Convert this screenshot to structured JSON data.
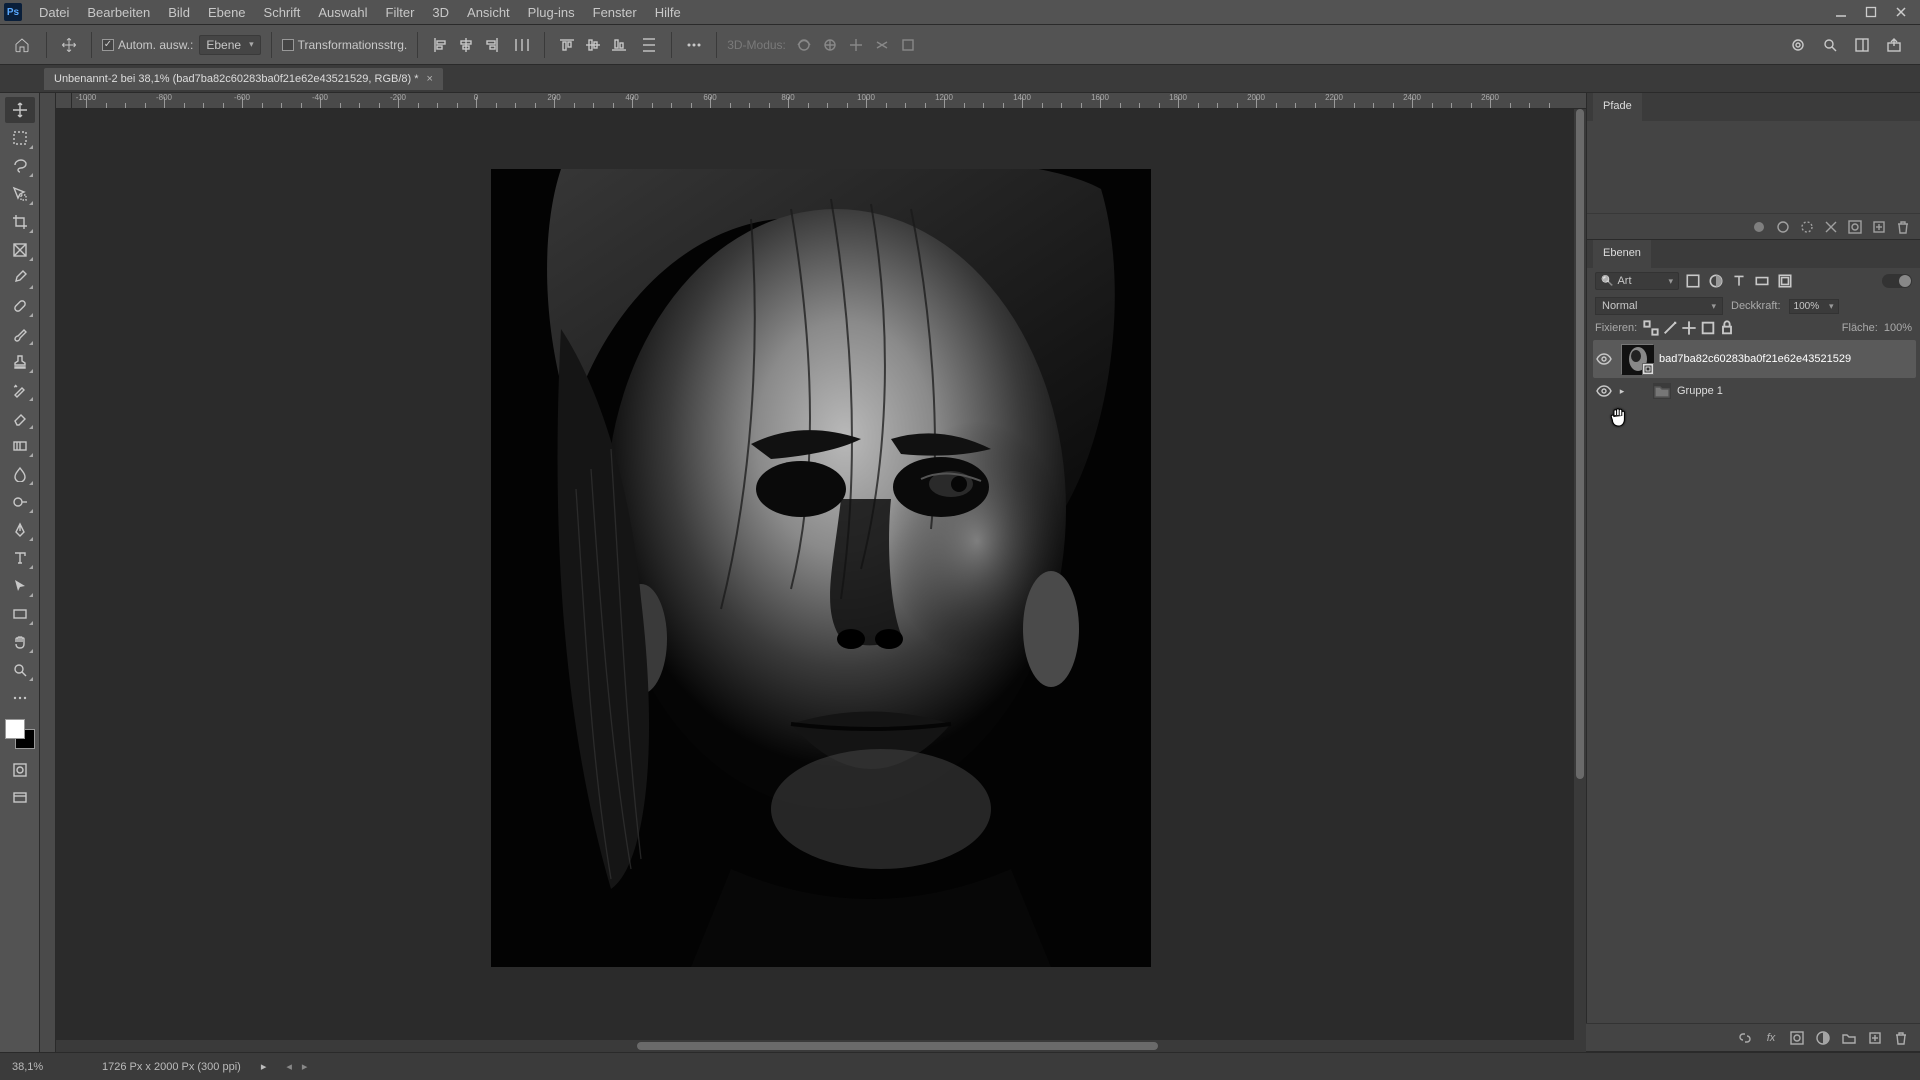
{
  "menubar": {
    "items": [
      "Datei",
      "Bearbeiten",
      "Bild",
      "Ebene",
      "Schrift",
      "Auswahl",
      "Filter",
      "3D",
      "Ansicht",
      "Plug-ins",
      "Fenster",
      "Hilfe"
    ]
  },
  "optbar": {
    "auto_select_label": "Autom. ausw.:",
    "auto_select_checked": true,
    "auto_select_target": "Ebene",
    "show_transform_label": "Transformationsstrg.",
    "show_transform_checked": false,
    "mode_3d_label": "3D-Modus:"
  },
  "document": {
    "tab_title": "Unbenannt-2 bei 38,1% (bad7ba82c60283ba0f21e62e43521529, RGB/8) *"
  },
  "ruler": {
    "h_labels": [
      "-1000",
      "-800",
      "-600",
      "-400",
      "-200",
      "0",
      "200",
      "400",
      "600",
      "800",
      "1000",
      "1200",
      "1400",
      "1600",
      "1800",
      "2000",
      "2200",
      "2400",
      "2600"
    ]
  },
  "panels": {
    "paths_tab": "Pfade",
    "layers_tab": "Ebenen",
    "search_kind": "Art",
    "blend_mode": "Normal",
    "opacity_label": "Deckkraft:",
    "opacity_value": "100%",
    "lock_label": "Fixieren:",
    "fill_label": "Fläche:",
    "fill_value": "100%",
    "layers": [
      {
        "name": "bad7ba82c60283ba0f21e62e43521529",
        "selected": true,
        "kind": "smart"
      },
      {
        "name": "Gruppe 1",
        "selected": false,
        "kind": "group"
      }
    ]
  },
  "status": {
    "zoom": "38,1%",
    "info": "1726 Px x 2000 Px (300 ppi)"
  }
}
